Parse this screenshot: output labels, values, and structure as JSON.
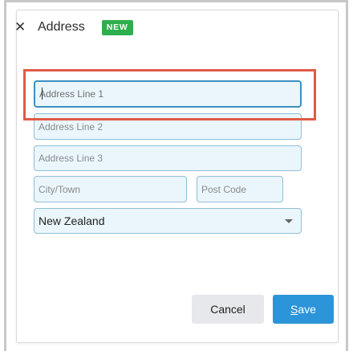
{
  "header": {
    "title": "Address",
    "badge": "NEW"
  },
  "form": {
    "address_line1_placeholder": "Address Line 1",
    "address_line2_placeholder": "Address Line 2",
    "address_line3_placeholder": "Address Line 3",
    "city_placeholder": "City/Town",
    "postcode_placeholder": "Post Code",
    "country_selected": "New Zealand"
  },
  "buttons": {
    "cancel_label": "Cancel",
    "save_label_first": "S",
    "save_label_rest": "ave"
  },
  "colors": {
    "badge_green": "#2fae4e",
    "save_blue": "#2c94d9",
    "highlight_red": "#e05a47",
    "field_bg": "#eaf6fc"
  }
}
